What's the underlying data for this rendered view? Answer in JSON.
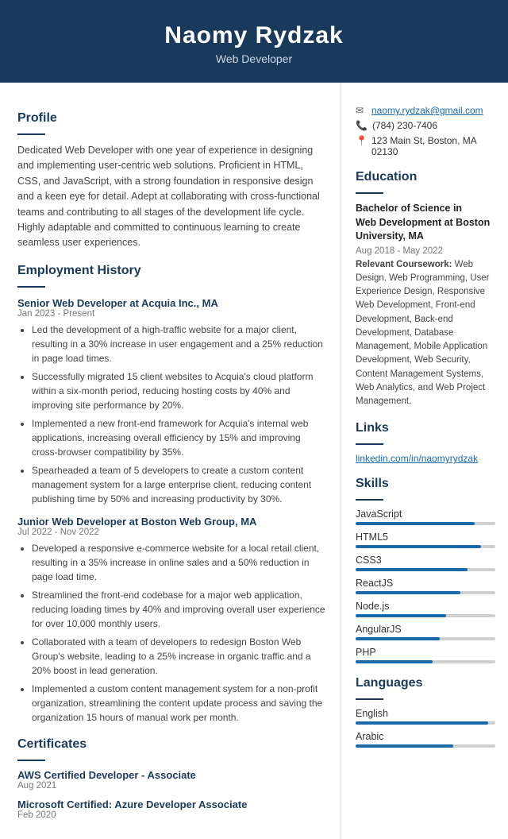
{
  "header": {
    "name": "Naomy Rydzak",
    "title": "Web Developer"
  },
  "contact": {
    "email": "naomy.rydzak@gmail.com",
    "phone": "(784) 230-7406",
    "address": "123 Main St, Boston, MA 02130"
  },
  "profile": {
    "section_title": "Profile",
    "text": "Dedicated Web Developer with one year of experience in designing and implementing user-centric web solutions. Proficient in HTML, CSS, and JavaScript, with a strong foundation in responsive design and a keen eye for detail. Adept at collaborating with cross-functional teams and contributing to all stages of the development life cycle. Highly adaptable and committed to continuous learning to create seamless user experiences."
  },
  "employment": {
    "section_title": "Employment History",
    "jobs": [
      {
        "title": "Senior Web Developer at Acquia Inc., MA",
        "date": "Jan 2023 - Present",
        "bullets": [
          "Led the development of a high-traffic website for a major client, resulting in a 30% increase in user engagement and a 25% reduction in page load times.",
          "Successfully migrated 15 client websites to Acquia's cloud platform within a six-month period, reducing hosting costs by 40% and improving site performance by 20%.",
          "Implemented a new front-end framework for Acquia's internal web applications, increasing overall efficiency by 15% and improving cross-browser compatibility by 35%.",
          "Spearheaded a team of 5 developers to create a custom content management system for a large enterprise client, reducing content publishing time by 50% and increasing productivity by 30%."
        ]
      },
      {
        "title": "Junior Web Developer at Boston Web Group, MA",
        "date": "Jul 2022 - Nov 2022",
        "bullets": [
          "Developed a responsive e-commerce website for a local retail client, resulting in a 35% increase in online sales and a 50% reduction in page load time.",
          "Streamlined the front-end codebase for a major web application, reducing loading times by 40% and improving overall user experience for over 10,000 monthly users.",
          "Collaborated with a team of developers to redesign Boston Web Group's website, leading to a 25% increase in organic traffic and a 20% boost in lead generation.",
          "Implemented a custom content management system for a non-profit organization, streamlining the content update process and saving the organization 15 hours of manual work per month."
        ]
      }
    ]
  },
  "certificates": {
    "section_title": "Certificates",
    "items": [
      {
        "name": "AWS Certified Developer - Associate",
        "date": "Aug 2021"
      },
      {
        "name": "Microsoft Certified: Azure Developer Associate",
        "date": "Feb 2020"
      }
    ]
  },
  "education": {
    "section_title": "Education",
    "degree": "Bachelor of Science in\nWeb Development at Boston University, MA",
    "date": "Aug 2018 - May 2022",
    "coursework_label": "Relevant Coursework:",
    "coursework": "Web Design, Web Programming, User Experience Design, Responsive Web Development, Front-end Development, Back-end Development, Database Management, Mobile Application Development, Web Security, Content Management Systems, Web Analytics, and Web Project Management."
  },
  "links": {
    "section_title": "Links",
    "items": [
      {
        "label": "linkedin.com/in/naomyrydzak",
        "url": "#"
      }
    ]
  },
  "skills": {
    "section_title": "Skills",
    "items": [
      {
        "label": "JavaScript",
        "pct": 85
      },
      {
        "label": "HTML5",
        "pct": 90
      },
      {
        "label": "CSS3",
        "pct": 80
      },
      {
        "label": "ReactJS",
        "pct": 75
      },
      {
        "label": "Node.js",
        "pct": 65
      },
      {
        "label": "AngularJS",
        "pct": 60
      },
      {
        "label": "PHP",
        "pct": 55
      }
    ]
  },
  "languages": {
    "section_title": "Languages",
    "items": [
      {
        "label": "English",
        "pct": 95
      },
      {
        "label": "Arabic",
        "pct": 70
      }
    ]
  }
}
